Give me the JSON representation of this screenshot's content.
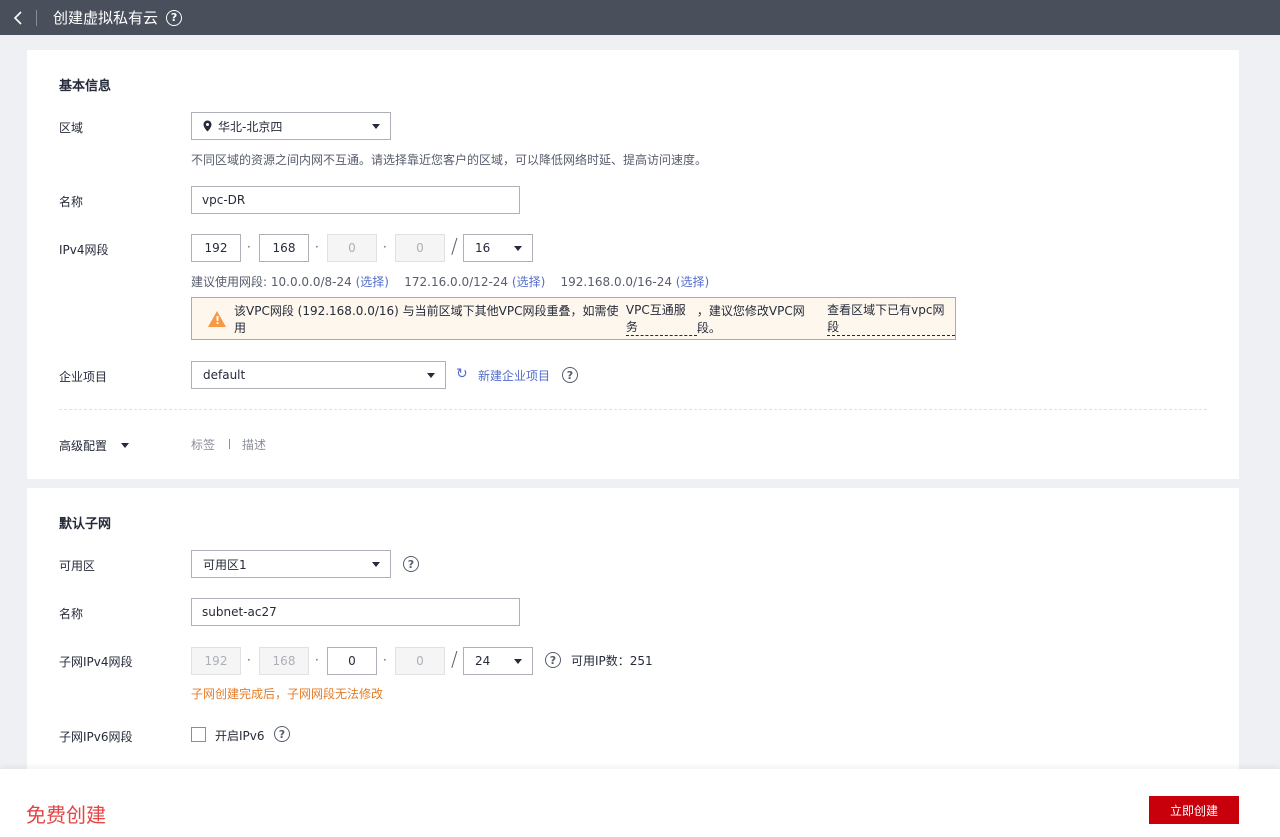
{
  "header": {
    "title": "创建虚拟私有云",
    "help": "?"
  },
  "basic": {
    "section_title": "基本信息",
    "region": {
      "label": "区域",
      "value": "华北-北京四",
      "hint": "不同区域的资源之间内网不互通。请选择靠近您客户的区域，可以降低网络时延、提高访问速度。"
    },
    "name": {
      "label": "名称",
      "value": "vpc-DR"
    },
    "ipv4": {
      "label": "IPv4网段",
      "octets": [
        "192",
        "168",
        "0",
        "0"
      ],
      "mask": "16",
      "suggest_prefix": "建议使用网段:",
      "suggestions": [
        {
          "cidr": "10.0.0.0/8-24",
          "action": "(选择)"
        },
        {
          "cidr": "172.16.0.0/12-24",
          "action": "(选择)"
        },
        {
          "cidr": "192.168.0.0/16-24",
          "action": "(选择)"
        }
      ],
      "warning": {
        "part1": "该VPC网段 (192.168.0.0/16) 与当前区域下其他VPC网段重叠，如需使用",
        "link1": "VPC互通服务",
        "part2": "，建议您修改VPC网段。",
        "link2": "查看区域下已有vpc网段"
      }
    },
    "enterprise": {
      "label": "企业项目",
      "value": "default",
      "new_link": "新建企业项目"
    },
    "advanced": {
      "label": "高级配置",
      "tag": "标签",
      "desc": "描述"
    }
  },
  "subnet": {
    "section_title": "默认子网",
    "az": {
      "label": "可用区",
      "value": "可用区1"
    },
    "name": {
      "label": "名称",
      "value": "subnet-ac27"
    },
    "ipv4": {
      "label": "子网IPv4网段",
      "octets": [
        "192",
        "168",
        "0",
        "0"
      ],
      "mask": "24",
      "available_label": "可用IP数：",
      "available": "251",
      "hint": "子网创建完成后，子网网段无法修改"
    },
    "ipv6": {
      "label": "子网IPv6网段",
      "checkbox_label": "开启IPv6"
    }
  },
  "footer": {
    "free": "免费创建",
    "create_button": "立即创建"
  },
  "colors": {
    "accent": "#526ecc",
    "primary_button": "#c7000b",
    "warning": "#fa9841",
    "free_text": "#e54545"
  }
}
